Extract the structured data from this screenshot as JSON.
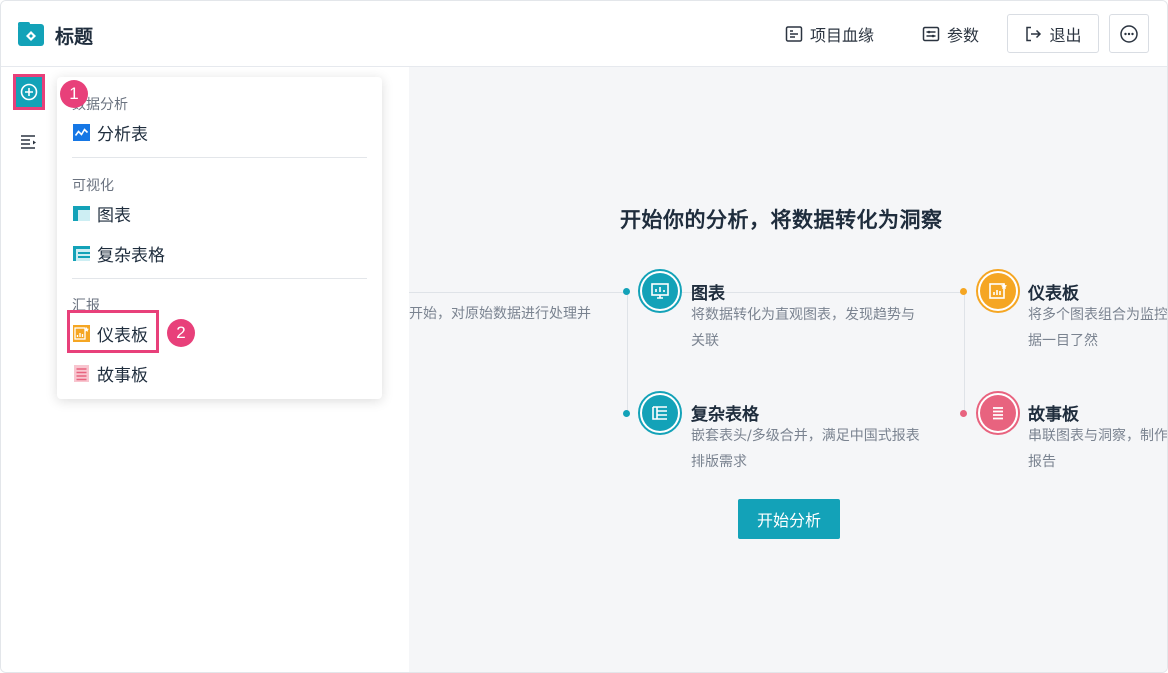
{
  "header": {
    "title": "标题",
    "lineage_label": "项目血缘",
    "params_label": "参数",
    "exit_label": "退出"
  },
  "main": {
    "hero_title": "开始你的分析，将数据转化为洞察",
    "partial_desc": "开始，对原始数据进行处理并",
    "features": {
      "chart": {
        "title": "图表",
        "desc_line1": "将数据转化为直观图表，发现趋势与",
        "desc_line2": "关联"
      },
      "dashboard": {
        "title": "仪表板",
        "desc_line1": "将多个图表组合为监控",
        "desc_line2": "据一目了然"
      },
      "complex_table": {
        "title": "复杂表格",
        "desc_line1": "嵌套表头/多级合并，满足中国式报表",
        "desc_line2": "排版需求"
      },
      "storyboard": {
        "title": "故事板",
        "desc_line1": "串联图表与洞察，制作",
        "desc_line2": "报告"
      }
    },
    "start_button": "开始分析"
  },
  "menu": {
    "group_data_analysis": "数据分析",
    "item_analysis_table": "分析表",
    "group_visualization": "可视化",
    "item_chart": "图表",
    "item_complex_table": "复杂表格",
    "group_report": "汇报",
    "item_dashboard": "仪表板",
    "item_storyboard": "故事板"
  },
  "badges": {
    "step1": "1",
    "step2": "2"
  },
  "colors": {
    "accent": "#13a2b8",
    "highlight": "#e8407a",
    "chart_icon": "#13a2b8",
    "dashboard_icon": "#f5a623",
    "storyboard_icon": "#e8637f"
  }
}
